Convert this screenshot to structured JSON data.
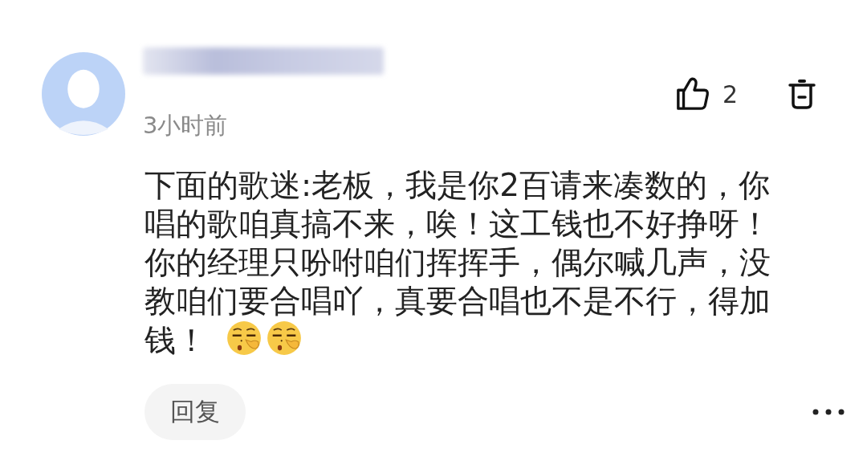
{
  "comment": {
    "time": "3小时前",
    "likes": "2",
    "text_lines": [
      "下面的歌迷:老板，我是你2百请来凑数的，你",
      "唱的歌咱真搞不来，唉！这工钱也不好挣呀！",
      "你的经理只吩咐咱们挥挥手，偶尔喊几声，没",
      "教咱们要合唱吖，真要合唱也不是不行，得加",
      "钱！"
    ],
    "reply_button": "回复"
  }
}
